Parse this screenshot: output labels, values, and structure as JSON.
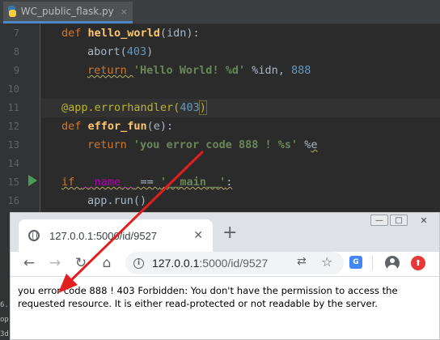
{
  "ide": {
    "tab_label": "WC_public_flask.py",
    "tab_close": "×",
    "lines": [
      {
        "num": "7"
      },
      {
        "num": "8"
      },
      {
        "num": "9"
      },
      {
        "num": "10"
      },
      {
        "num": "11"
      },
      {
        "num": "12"
      },
      {
        "num": "13"
      },
      {
        "num": "14"
      },
      {
        "num": "15"
      },
      {
        "num": "16"
      }
    ],
    "code": {
      "l7_def": "def ",
      "l7_fn": "hello_world",
      "l7_args": "(idn):",
      "l8_call": "abort(",
      "l8_num": "403",
      "l8_close": ")",
      "l9_return": "return ",
      "l9_str": "'Hello World! %d'",
      "l9_mid": " %idn, ",
      "l9_num": "888",
      "l11_deco": "@app.errorhandler(",
      "l11_num": "403",
      "l11_close": ")",
      "l12_def": "def ",
      "l12_fn": "effor_fun",
      "l12_args": "(e):",
      "l13_return": "return ",
      "l13_str": "'you error code 888 ! %s'",
      "l13_mid": " %",
      "l13_var": "e",
      "l15_if": "if ",
      "l15_name": "__name__",
      "l15_eq": " == ",
      "l15_str": "'__main__'",
      "l15_colon": ":",
      "l16_call": "app.run()"
    },
    "side_clip": [
      "6.",
      "op",
      "3d"
    ]
  },
  "browser": {
    "tab_title": "127.0.0.1:5000/id/9527",
    "tab_close": "✕",
    "new_tab": "+",
    "win_min": "—",
    "win_max": "□",
    "win_close": "✕",
    "back": "←",
    "forward": "→",
    "reload": "↻",
    "home": "⌂",
    "info": "i",
    "url_host": "127.0.0.1",
    "url_path": ":5000/id/9527",
    "translate": "⇄",
    "bookmark": "☆",
    "translate_ext": "G",
    "ext_red": "⬆",
    "page_text": "you error code 888 ! 403 Forbidden: You don't have the permission to access the requested resource. It is either read-protected or not readable by the server."
  },
  "colors": {
    "annotation_arrow": "#e31e1e",
    "ide_background": "#2b2b2b",
    "keyword": "#cc7832",
    "string": "#6a8759",
    "number": "#6897bb",
    "function": "#ffc66d"
  }
}
